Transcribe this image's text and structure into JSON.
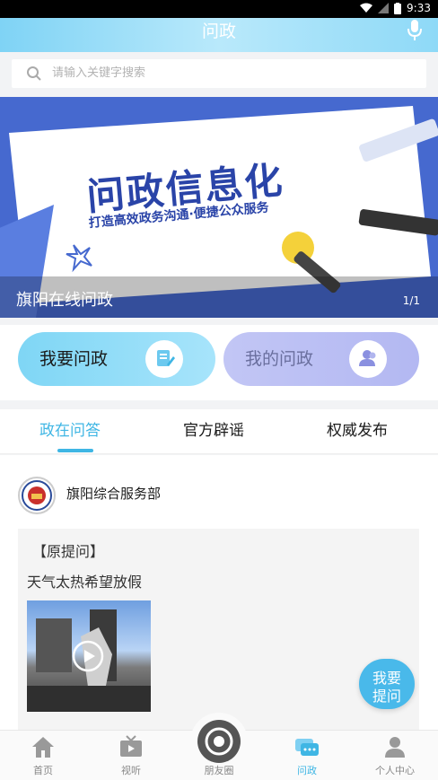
{
  "status_bar": {
    "time": "9:33"
  },
  "header": {
    "title": "问政"
  },
  "search": {
    "placeholder": "请输入关键字搜索"
  },
  "banner": {
    "title": "问政信息化",
    "subtitle": "打造高效政务沟通·便捷公众服务",
    "caption": "旗阳在线问政",
    "indicator": "1/1"
  },
  "actions": [
    {
      "label": "我要问政",
      "icon": "edit-icon"
    },
    {
      "label": "我的问政",
      "icon": "user-icon"
    }
  ],
  "tabs": [
    {
      "label": "政在问答",
      "active": true
    },
    {
      "label": "官方辟谣",
      "active": false
    },
    {
      "label": "权威发布",
      "active": false
    }
  ],
  "feed": {
    "org_name": "旗阳综合服务部",
    "question_tag": "【原提问】",
    "question_text": "天气太热希望放假"
  },
  "fab": {
    "line1": "我要",
    "line2": "提问"
  },
  "bottom_nav": [
    {
      "label": "首页",
      "icon": "home-icon"
    },
    {
      "label": "视听",
      "icon": "tv-icon"
    },
    {
      "label": "朋友圈",
      "icon": "camera-shutter-icon"
    },
    {
      "label": "问政",
      "icon": "chat-icon",
      "active": true
    },
    {
      "label": "个人中心",
      "icon": "person-icon"
    }
  ],
  "colors": {
    "accent": "#3fb6e4",
    "header_gradient_start": "#7fd3f5",
    "banner_bg": "#3d63c8",
    "fab": "#49b9ea"
  }
}
